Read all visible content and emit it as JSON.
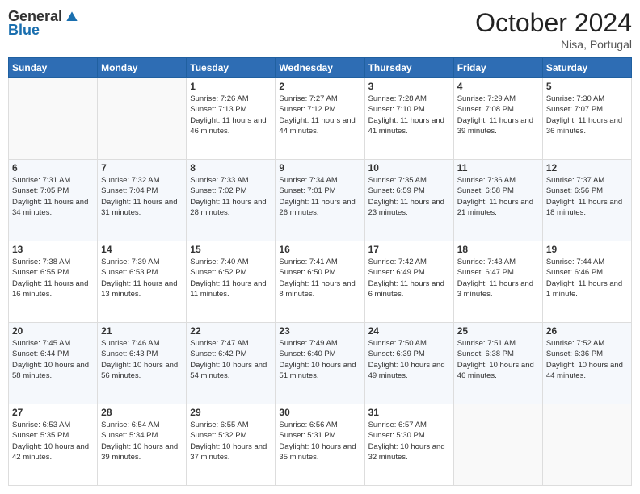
{
  "header": {
    "logo_general": "General",
    "logo_blue": "Blue",
    "month_title": "October 2024",
    "subtitle": "Nisa, Portugal"
  },
  "days_of_week": [
    "Sunday",
    "Monday",
    "Tuesday",
    "Wednesday",
    "Thursday",
    "Friday",
    "Saturday"
  ],
  "weeks": [
    [
      {
        "day": "",
        "info": ""
      },
      {
        "day": "",
        "info": ""
      },
      {
        "day": "1",
        "info": "Sunrise: 7:26 AM\nSunset: 7:13 PM\nDaylight: 11 hours and 46 minutes."
      },
      {
        "day": "2",
        "info": "Sunrise: 7:27 AM\nSunset: 7:12 PM\nDaylight: 11 hours and 44 minutes."
      },
      {
        "day": "3",
        "info": "Sunrise: 7:28 AM\nSunset: 7:10 PM\nDaylight: 11 hours and 41 minutes."
      },
      {
        "day": "4",
        "info": "Sunrise: 7:29 AM\nSunset: 7:08 PM\nDaylight: 11 hours and 39 minutes."
      },
      {
        "day": "5",
        "info": "Sunrise: 7:30 AM\nSunset: 7:07 PM\nDaylight: 11 hours and 36 minutes."
      }
    ],
    [
      {
        "day": "6",
        "info": "Sunrise: 7:31 AM\nSunset: 7:05 PM\nDaylight: 11 hours and 34 minutes."
      },
      {
        "day": "7",
        "info": "Sunrise: 7:32 AM\nSunset: 7:04 PM\nDaylight: 11 hours and 31 minutes."
      },
      {
        "day": "8",
        "info": "Sunrise: 7:33 AM\nSunset: 7:02 PM\nDaylight: 11 hours and 28 minutes."
      },
      {
        "day": "9",
        "info": "Sunrise: 7:34 AM\nSunset: 7:01 PM\nDaylight: 11 hours and 26 minutes."
      },
      {
        "day": "10",
        "info": "Sunrise: 7:35 AM\nSunset: 6:59 PM\nDaylight: 11 hours and 23 minutes."
      },
      {
        "day": "11",
        "info": "Sunrise: 7:36 AM\nSunset: 6:58 PM\nDaylight: 11 hours and 21 minutes."
      },
      {
        "day": "12",
        "info": "Sunrise: 7:37 AM\nSunset: 6:56 PM\nDaylight: 11 hours and 18 minutes."
      }
    ],
    [
      {
        "day": "13",
        "info": "Sunrise: 7:38 AM\nSunset: 6:55 PM\nDaylight: 11 hours and 16 minutes."
      },
      {
        "day": "14",
        "info": "Sunrise: 7:39 AM\nSunset: 6:53 PM\nDaylight: 11 hours and 13 minutes."
      },
      {
        "day": "15",
        "info": "Sunrise: 7:40 AM\nSunset: 6:52 PM\nDaylight: 11 hours and 11 minutes."
      },
      {
        "day": "16",
        "info": "Sunrise: 7:41 AM\nSunset: 6:50 PM\nDaylight: 11 hours and 8 minutes."
      },
      {
        "day": "17",
        "info": "Sunrise: 7:42 AM\nSunset: 6:49 PM\nDaylight: 11 hours and 6 minutes."
      },
      {
        "day": "18",
        "info": "Sunrise: 7:43 AM\nSunset: 6:47 PM\nDaylight: 11 hours and 3 minutes."
      },
      {
        "day": "19",
        "info": "Sunrise: 7:44 AM\nSunset: 6:46 PM\nDaylight: 11 hours and 1 minute."
      }
    ],
    [
      {
        "day": "20",
        "info": "Sunrise: 7:45 AM\nSunset: 6:44 PM\nDaylight: 10 hours and 58 minutes."
      },
      {
        "day": "21",
        "info": "Sunrise: 7:46 AM\nSunset: 6:43 PM\nDaylight: 10 hours and 56 minutes."
      },
      {
        "day": "22",
        "info": "Sunrise: 7:47 AM\nSunset: 6:42 PM\nDaylight: 10 hours and 54 minutes."
      },
      {
        "day": "23",
        "info": "Sunrise: 7:49 AM\nSunset: 6:40 PM\nDaylight: 10 hours and 51 minutes."
      },
      {
        "day": "24",
        "info": "Sunrise: 7:50 AM\nSunset: 6:39 PM\nDaylight: 10 hours and 49 minutes."
      },
      {
        "day": "25",
        "info": "Sunrise: 7:51 AM\nSunset: 6:38 PM\nDaylight: 10 hours and 46 minutes."
      },
      {
        "day": "26",
        "info": "Sunrise: 7:52 AM\nSunset: 6:36 PM\nDaylight: 10 hours and 44 minutes."
      }
    ],
    [
      {
        "day": "27",
        "info": "Sunrise: 6:53 AM\nSunset: 5:35 PM\nDaylight: 10 hours and 42 minutes."
      },
      {
        "day": "28",
        "info": "Sunrise: 6:54 AM\nSunset: 5:34 PM\nDaylight: 10 hours and 39 minutes."
      },
      {
        "day": "29",
        "info": "Sunrise: 6:55 AM\nSunset: 5:32 PM\nDaylight: 10 hours and 37 minutes."
      },
      {
        "day": "30",
        "info": "Sunrise: 6:56 AM\nSunset: 5:31 PM\nDaylight: 10 hours and 35 minutes."
      },
      {
        "day": "31",
        "info": "Sunrise: 6:57 AM\nSunset: 5:30 PM\nDaylight: 10 hours and 32 minutes."
      },
      {
        "day": "",
        "info": ""
      },
      {
        "day": "",
        "info": ""
      }
    ]
  ]
}
